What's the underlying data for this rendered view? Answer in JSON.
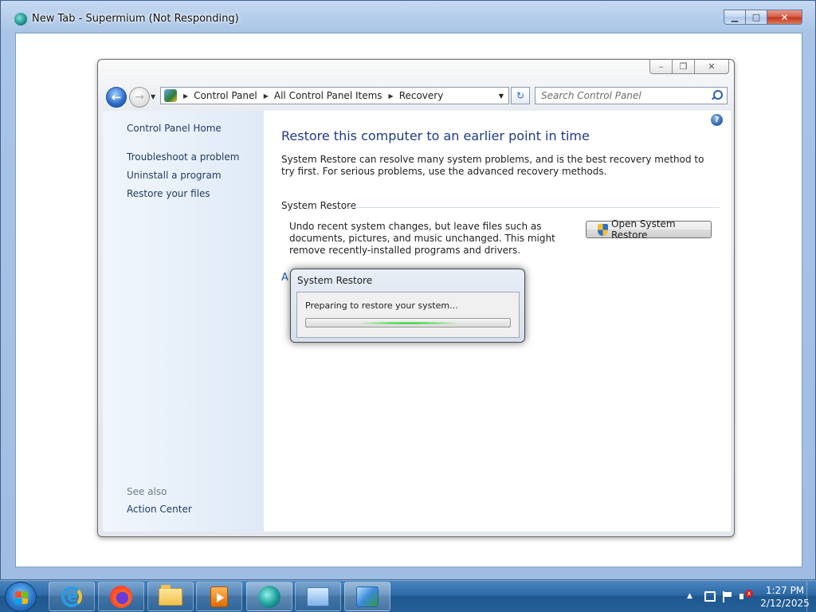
{
  "browser": {
    "title": "New Tab - Supermium (Not Responding)",
    "icon": "supermium-icon"
  },
  "control_panel": {
    "breadcrumb": [
      "Control Panel",
      "All Control Panel Items",
      "Recovery"
    ],
    "search": {
      "placeholder": "Search Control Panel",
      "value": ""
    },
    "left_nav": {
      "home": "Control Panel Home",
      "links": [
        "Troubleshoot a problem",
        "Uninstall a program",
        "Restore your files"
      ],
      "see_also_label": "See also",
      "see_also_links": [
        "Action Center"
      ]
    },
    "content": {
      "title": "Restore this computer to an earlier point in time",
      "description": "System Restore can resolve many system problems, and is the best recovery method to try first. For serious problems, use the advanced recovery methods.",
      "section": {
        "header": "System Restore",
        "description": "Undo recent system changes, but leave files such as documents, pictures, and music unchanged. This might remove recently-installed programs and drivers.",
        "button_label": "Open System Restore"
      },
      "obscured_link": "A"
    }
  },
  "dialog": {
    "title": "System Restore",
    "message": "Preparing to restore your system...",
    "progress": {
      "type": "marquee",
      "glow_position": 0.5
    }
  },
  "taskbar": {
    "apps": [
      {
        "name": "internet-explorer",
        "icon": "ie-icon",
        "active": false
      },
      {
        "name": "firefox",
        "icon": "firefox-icon",
        "active": false
      },
      {
        "name": "windows-explorer",
        "icon": "folder-icon",
        "active": false
      },
      {
        "name": "media-player",
        "icon": "media-icon",
        "active": false
      },
      {
        "name": "supermium",
        "icon": "supermium-icon",
        "active": true
      },
      {
        "name": "control-panel",
        "icon": "cpl-icon",
        "active": false
      },
      {
        "name": "system-restore",
        "icon": "sr-icon",
        "active": true
      }
    ],
    "clock": {
      "time": "1:27 PM",
      "date": "2/12/2025"
    }
  },
  "colors": {
    "link": "#1e3a5f",
    "title": "#1e3a8a",
    "taskbar": "#2d6aa6",
    "progress_glow": "#1ec81e"
  }
}
